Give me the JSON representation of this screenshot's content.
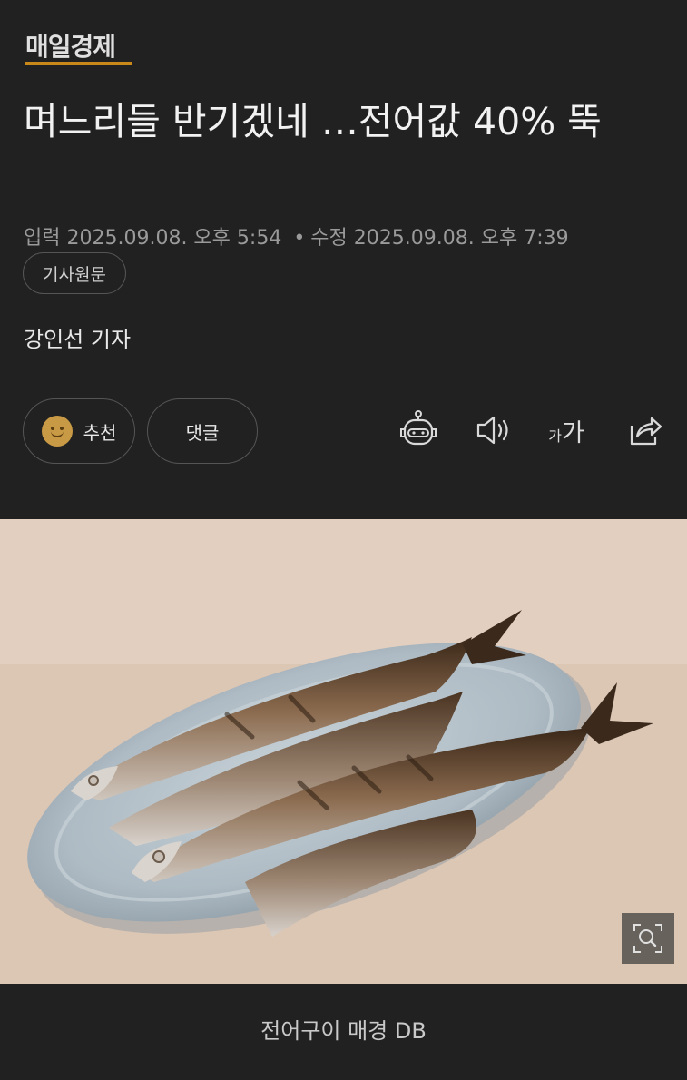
{
  "header": {
    "brand": "매일경제",
    "headline": "며느리들 반기겠네 …전어값 40% 뚝",
    "meta": {
      "input_label": "입력",
      "input_time": "2025.09.08. 오후 5:54",
      "separator": "•",
      "edit_label": "수정",
      "edit_time": "2025.09.08. 오후 7:39"
    },
    "source_link": "기사원문",
    "reporter": "강인선 기자"
  },
  "actions": {
    "recommend_label": "추천",
    "comment_label": "댓글",
    "font_small": "가",
    "font_big": "가",
    "icons": [
      "robot-icon",
      "speaker-icon",
      "font-size-icon",
      "share-icon"
    ]
  },
  "photo": {
    "caption": "전어구이 매경 DB",
    "subject": "grilled-gizzard-shad-on-plate"
  },
  "colors": {
    "background": "#212121",
    "brand_underline": "#c8891a",
    "border": "#555555"
  }
}
